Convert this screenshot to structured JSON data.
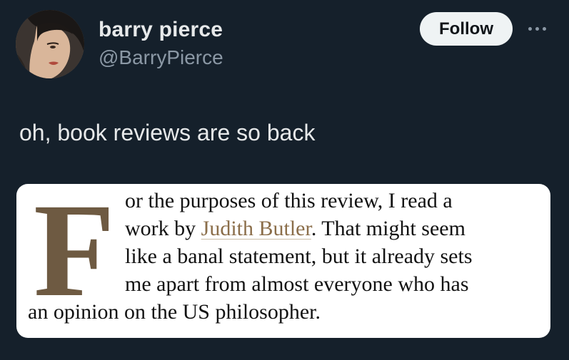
{
  "author": {
    "display_name": "barry pierce",
    "handle": "@BarryPierce",
    "avatar_icon": "profile-avatar"
  },
  "actions": {
    "follow_label": "Follow",
    "more_icon": "ellipsis-icon"
  },
  "tweet": {
    "text": "oh, book reviews are so back"
  },
  "quote": {
    "drop_cap": "F",
    "line1": "or the purposes of this review, I read a",
    "line2_before": "work by ",
    "line2_link": "Judith Butler",
    "line2_after": ". That might seem",
    "line3": "like a banal statement, but it already sets",
    "line4": "me apart from almost everyone who has",
    "line5": "an opinion on the US philosopher."
  },
  "colors": {
    "background": "#15202b",
    "drop_cap": "#6e5a42",
    "link": "#8b6e4a",
    "follow_button": "#eff3f4"
  }
}
